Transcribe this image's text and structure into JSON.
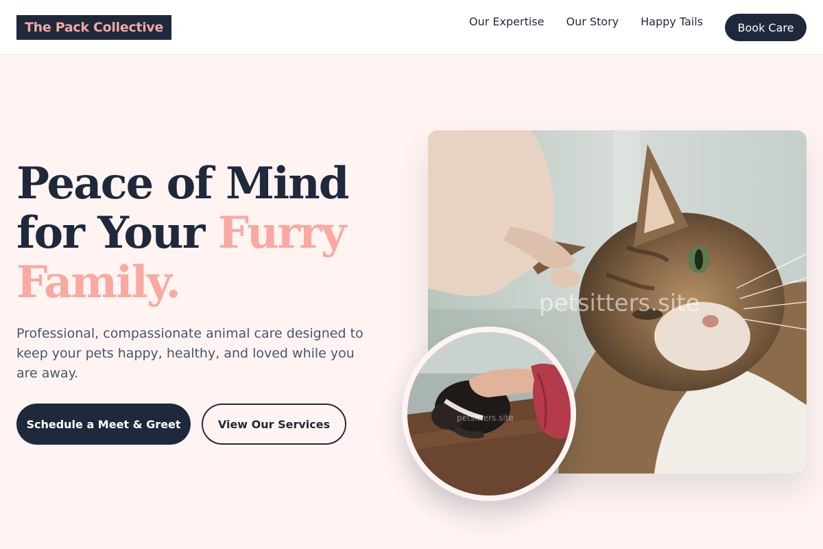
{
  "brand": {
    "logo_text": "The Pack Collective"
  },
  "nav": {
    "links": [
      "Our Expertise",
      "Our Story",
      "Happy Tails"
    ],
    "cta_label": "Book Care"
  },
  "hero": {
    "title_line1": "Peace of Mind",
    "title_line2_plain": "for Your ",
    "title_line2_accent": "Furry",
    "title_line3_accent": "Family.",
    "description": "Professional, compassionate animal care designed to keep your pets happy, healthy, and loved while you are away.",
    "primary_button": "Schedule a Meet & Greet",
    "secondary_button": "View Our Services"
  },
  "images": {
    "main_watermark": "petsitters.site",
    "inset_watermark": "petsitters.site"
  },
  "colors": {
    "navy": "#1e293b",
    "accent_pink": "#f9a9a0",
    "background": "#fff4f2"
  }
}
